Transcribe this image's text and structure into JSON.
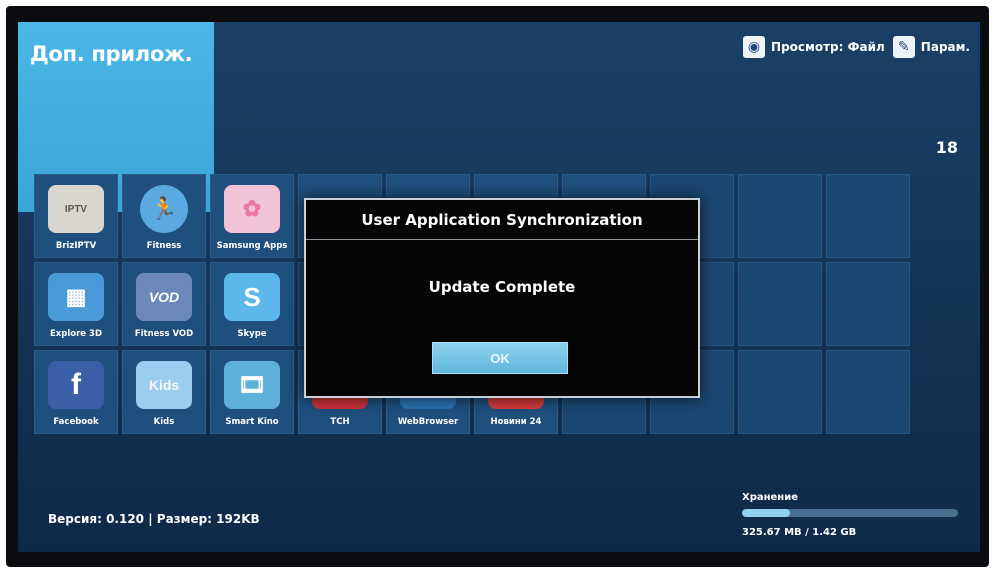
{
  "header": {
    "title": "Доп. прилож.",
    "view_label": "Просмотр: Файл",
    "view_icon": "disc-icon",
    "params_label": "Парам.",
    "params_icon": "edit-icon",
    "app_count": "18"
  },
  "apps": [
    {
      "label": "BrizIPTV",
      "icon": "briziptv-icon",
      "color": "#d9d6d0",
      "glyph": "IPTV"
    },
    {
      "label": "Fitness",
      "icon": "fitness-runner-icon",
      "color": "#5aa9e0",
      "glyph": "🏃"
    },
    {
      "label": "Samsung Apps",
      "icon": "samsung-apps-icon",
      "color": "#f2a7c3",
      "glyph": "✿"
    },
    {
      "label": "Explore 3D",
      "icon": "explore-3d-icon",
      "color": "#4a9ad8",
      "glyph": "▦"
    },
    {
      "label": "Fitness VOD",
      "icon": "fitness-vod-icon",
      "color": "#6b88b8",
      "glyph": "VOD"
    },
    {
      "label": "Skype",
      "icon": "skype-icon",
      "color": "#5cb8ea",
      "glyph": "S"
    },
    {
      "label": "Facebook",
      "icon": "facebook-icon",
      "color": "#3b5fa6",
      "glyph": "f"
    },
    {
      "label": "Kids",
      "icon": "kids-icon",
      "color": "#9acdf0",
      "glyph": "Kids"
    },
    {
      "label": "Smart Kino",
      "icon": "smart-kino-icon",
      "color": "#5fb0d8",
      "glyph": "🎞"
    },
    {
      "label": "TCH",
      "icon": "tch-icon",
      "color": "#c8303a",
      "glyph": ""
    },
    {
      "label": "WebBrowser",
      "icon": "web-browser-icon",
      "color": "#2a6fb0",
      "glyph": ""
    },
    {
      "label": "Новини 24",
      "icon": "novyny-24-icon",
      "color": "#d03a3a",
      "glyph": ""
    }
  ],
  "dialog": {
    "title": "User Application Synchronization",
    "message": "Update Complete",
    "ok_label": "OK"
  },
  "footer": {
    "version_text": "Версия: 0.120 | Размер: 192KB",
    "storage_label": "Хранение",
    "storage_value": "325.67 MB / 1.42 GB",
    "storage_fraction": 0.22
  }
}
